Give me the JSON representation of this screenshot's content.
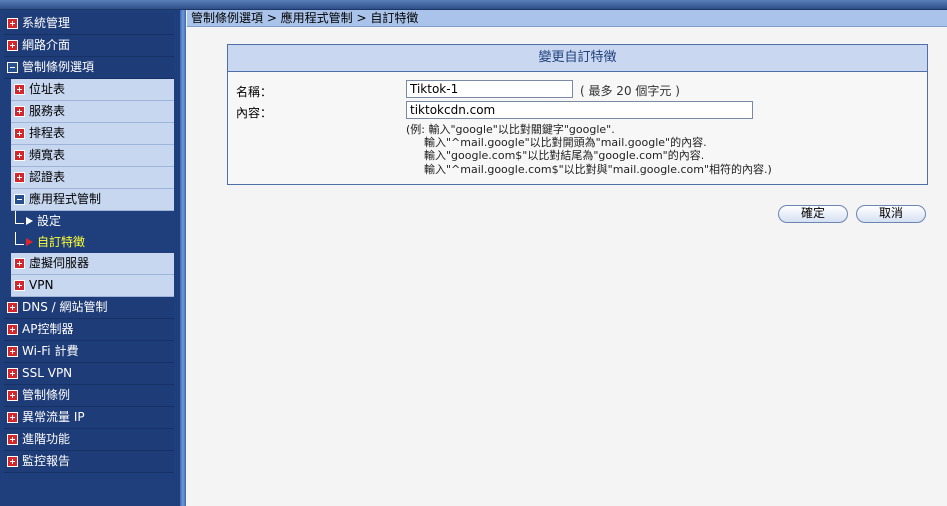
{
  "sidebar": {
    "items": [
      {
        "label": "系統管理",
        "state": "plus"
      },
      {
        "label": "網路介面",
        "state": "plus"
      },
      {
        "label": "管制條例選項",
        "state": "minus"
      }
    ],
    "sub_items": [
      {
        "label": "位址表",
        "state": "plus"
      },
      {
        "label": "服務表",
        "state": "plus"
      },
      {
        "label": "排程表",
        "state": "plus"
      },
      {
        "label": "頻寬表",
        "state": "plus"
      },
      {
        "label": "認證表",
        "state": "plus"
      },
      {
        "label": "應用程式管制",
        "state": "minus"
      }
    ],
    "leaves": [
      {
        "label": "設定"
      },
      {
        "label": "自訂特徵"
      }
    ],
    "sub_items_after": [
      {
        "label": "虛擬伺服器",
        "state": "plus"
      },
      {
        "label": "VPN",
        "state": "plus"
      }
    ],
    "items_after": [
      {
        "label": "DNS / 網站管制"
      },
      {
        "label": "AP控制器"
      },
      {
        "label": "Wi-Fi 計費"
      },
      {
        "label": "SSL VPN"
      },
      {
        "label": "管制條例"
      },
      {
        "label": "異常流量 IP"
      },
      {
        "label": "進階功能"
      },
      {
        "label": "監控報告"
      }
    ]
  },
  "breadcrumb": "管制條例選項 > 應用程式管制 > 自訂特徵",
  "form": {
    "title": "變更自訂特徵",
    "name_label": "名稱：",
    "name_value": "Tiktok-1",
    "name_hint": "( 最多 20 個字元 )",
    "content_label": "內容：",
    "content_value": "tiktokcdn.com",
    "example_lines": [
      "(例: 輸入\"google\"以比對關鍵字\"google\".",
      "輸入\"^mail.google\"以比對開頭為\"mail.google\"的內容.",
      "輸入\"google.com$\"以比對結尾為\"google.com\"的內容.",
      "輸入\"^mail.google.com$\"以比對與\"mail.google.com\"相符的內容.)"
    ]
  },
  "buttons": {
    "ok": "確定",
    "cancel": "取消"
  },
  "colors": {
    "sidebar_bg": "#1f3f7c",
    "submenu_bg": "#c7d7f0",
    "active_text": "#ffff33",
    "plus_icon": "#d4262b"
  }
}
